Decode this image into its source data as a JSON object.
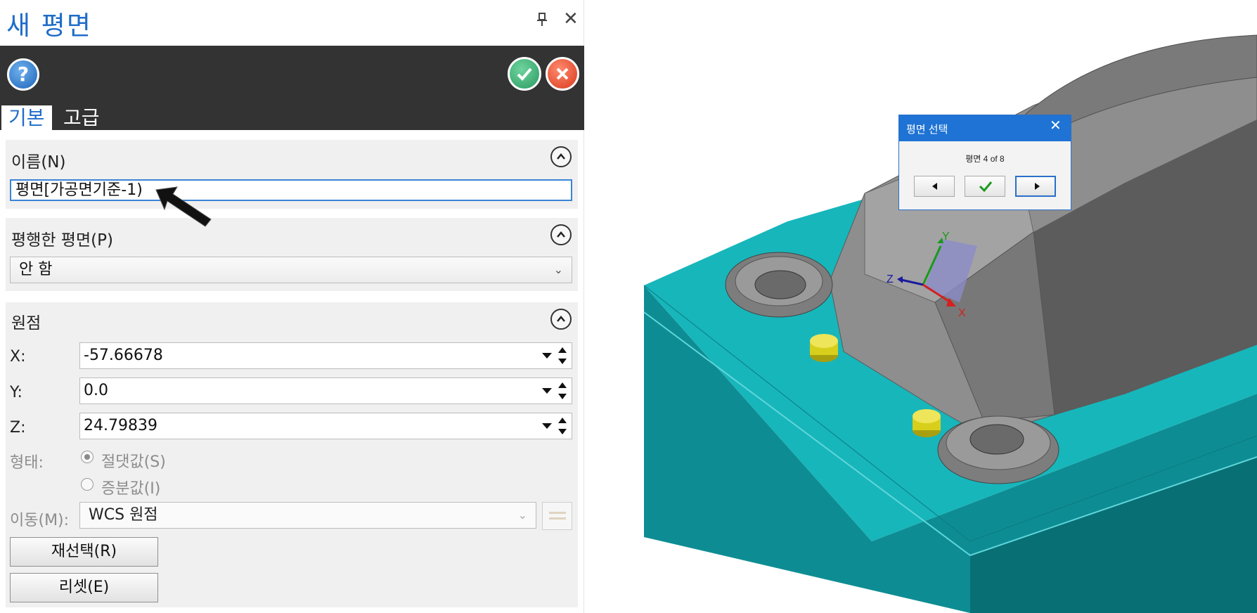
{
  "panel": {
    "title": "새 평면",
    "pin_icon": "📌",
    "tabs": [
      {
        "label": "기본",
        "active": true
      },
      {
        "label": "고급",
        "active": false
      }
    ],
    "name_section": {
      "title": "이름(N)",
      "value": "평면[가공면기준-1)"
    },
    "parallel_section": {
      "title": "평행한 평면(P)",
      "selected": "안 함"
    },
    "origin_section": {
      "title": "원점",
      "x_label": "X:",
      "x_value": "-57.66678",
      "y_label": "Y:",
      "y_value": "0.0",
      "z_label": "Z:",
      "z_value": "24.79839",
      "form_label": "형태:",
      "radio_absolute": "절댓값(S)",
      "radio_incremental": "증분값(I)",
      "selected_mode": "absolute",
      "move_label": "이동(M):",
      "move_value": "WCS 원점",
      "reselect_button": "재선택(R)",
      "reset_button": "리셋(E)"
    }
  },
  "popup": {
    "title": "평면 선택",
    "count": "평면 4 of 8"
  },
  "viewport": {
    "axis_x": "X",
    "axis_y": "Y",
    "axis_z": "Z"
  },
  "colors": {
    "accent": "#1f6cc8",
    "toolbar": "#333333",
    "fixture": "#17b6bb",
    "part": "#8e8e8e",
    "pin": "#d8cf1c"
  }
}
